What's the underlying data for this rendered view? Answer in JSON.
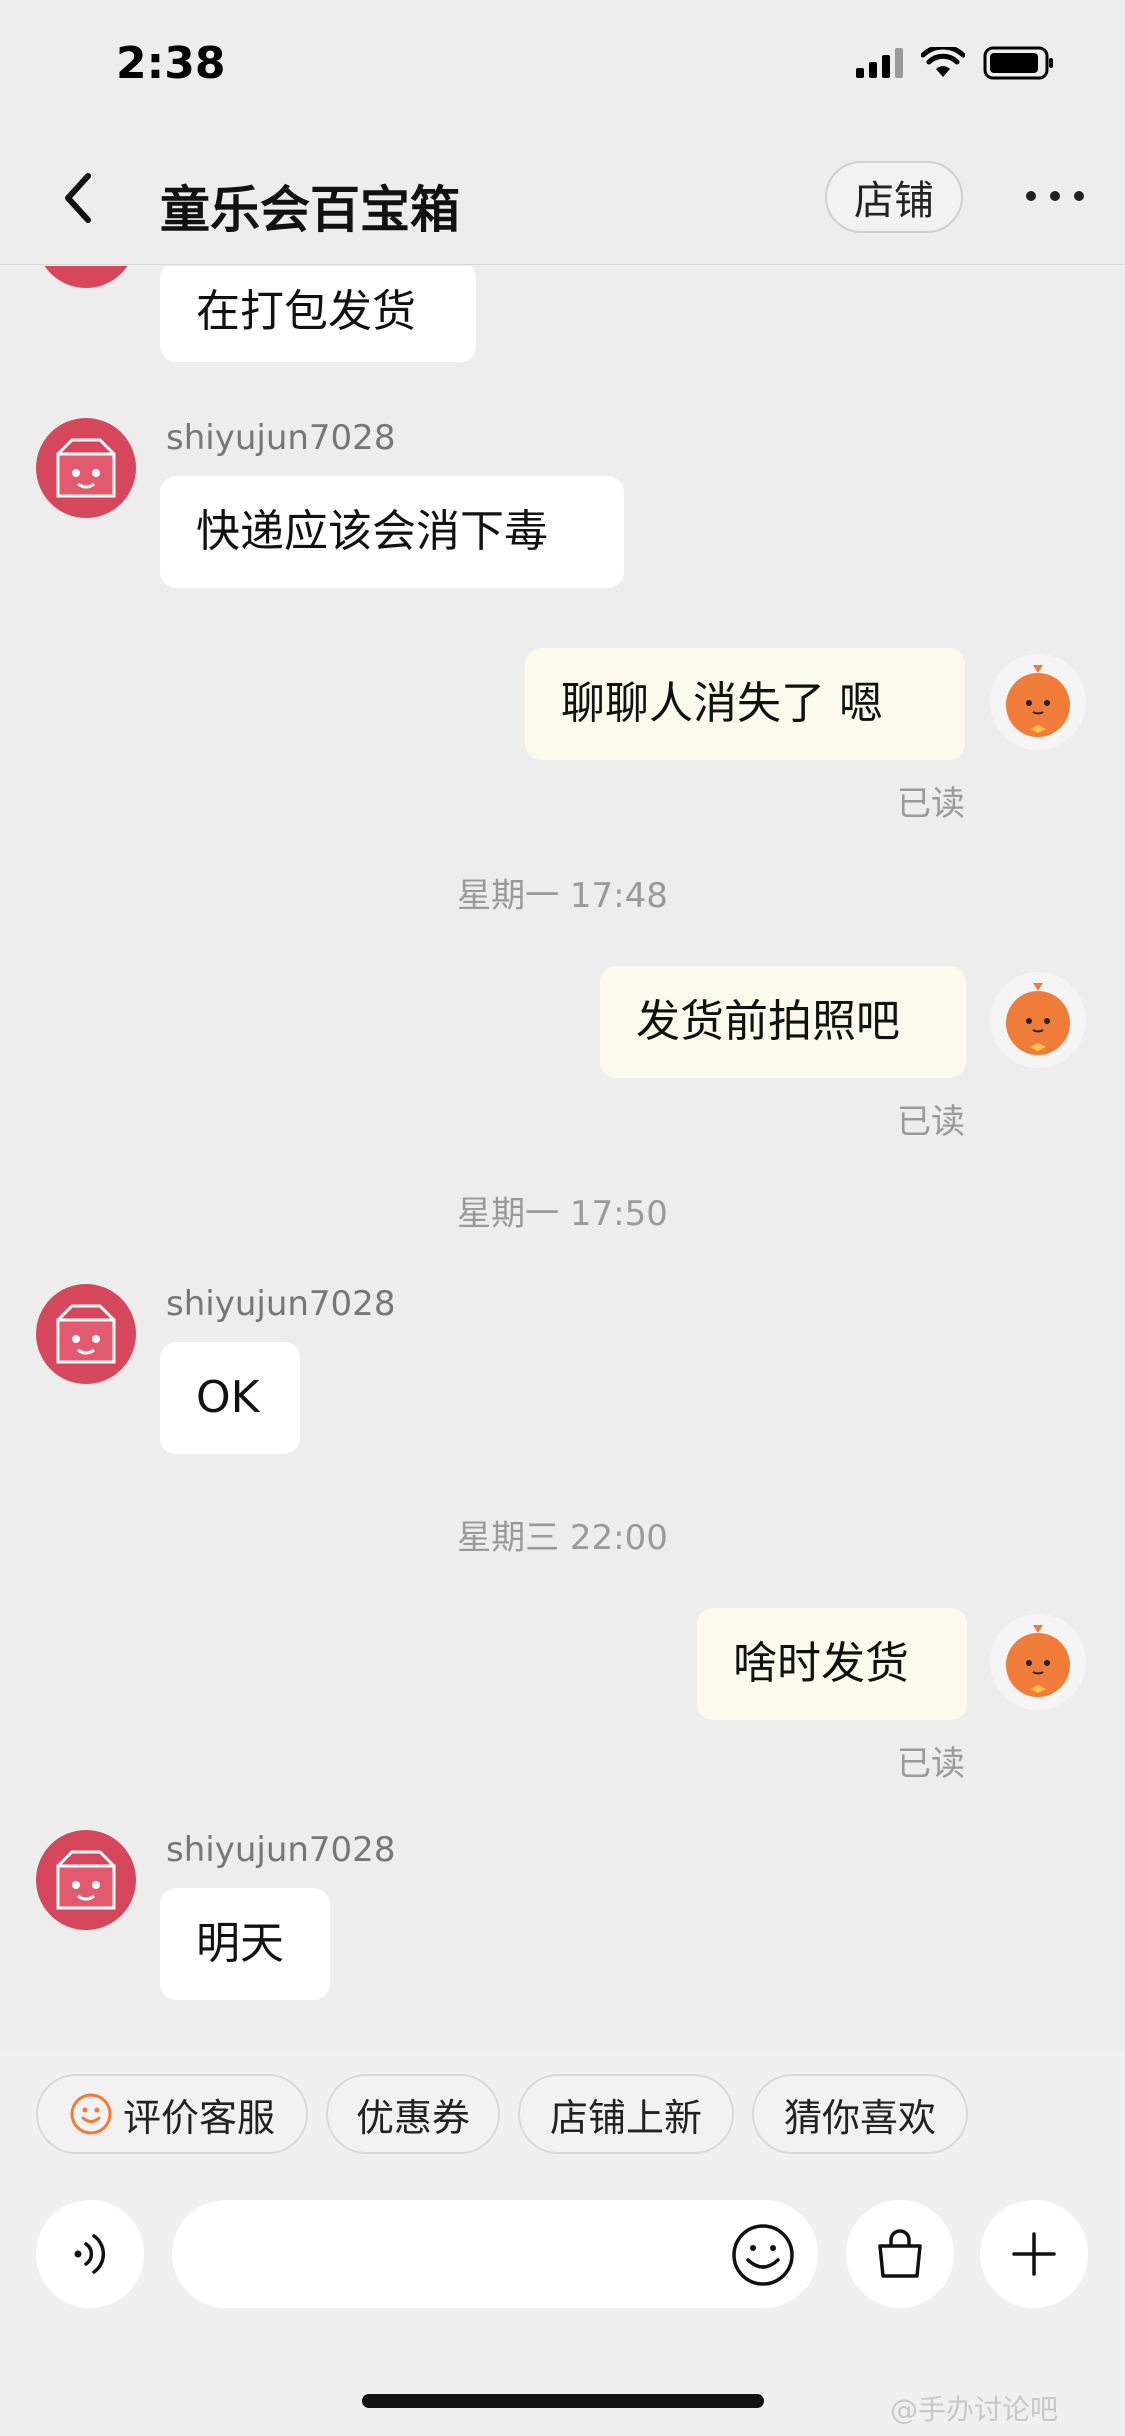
{
  "status_bar": {
    "time": "2:38"
  },
  "header": {
    "title": "童乐会百宝箱",
    "store_button": "店铺"
  },
  "messages": [
    {
      "text": "在打包发货"
    },
    {
      "sender": "shiyujun7028",
      "text": "快递应该会消下毒"
    },
    {
      "text": "聊聊人消失了  嗯",
      "read": "已读"
    },
    {
      "timestamp": "星期一 17:48"
    },
    {
      "text": "发货前拍照吧",
      "read": "已读"
    },
    {
      "timestamp": "星期一 17:50"
    },
    {
      "sender": "shiyujun7028",
      "text": "OK"
    },
    {
      "timestamp": "星期三 22:00"
    },
    {
      "text": "啥时发货",
      "read": "已读"
    },
    {
      "sender": "shiyujun7028",
      "text": "明天"
    }
  ],
  "quick_replies": [
    "评价客服",
    "优惠券",
    "店铺上新",
    "猜你喜欢"
  ],
  "input": {
    "placeholder": ""
  },
  "watermark": "@手办讨论吧",
  "colors": {
    "outgoing_bubble": "#fdf9ec",
    "incoming_bubble": "#ffffff",
    "accent_orange": "#f07c3a",
    "shop_avatar": "#d7475b"
  }
}
